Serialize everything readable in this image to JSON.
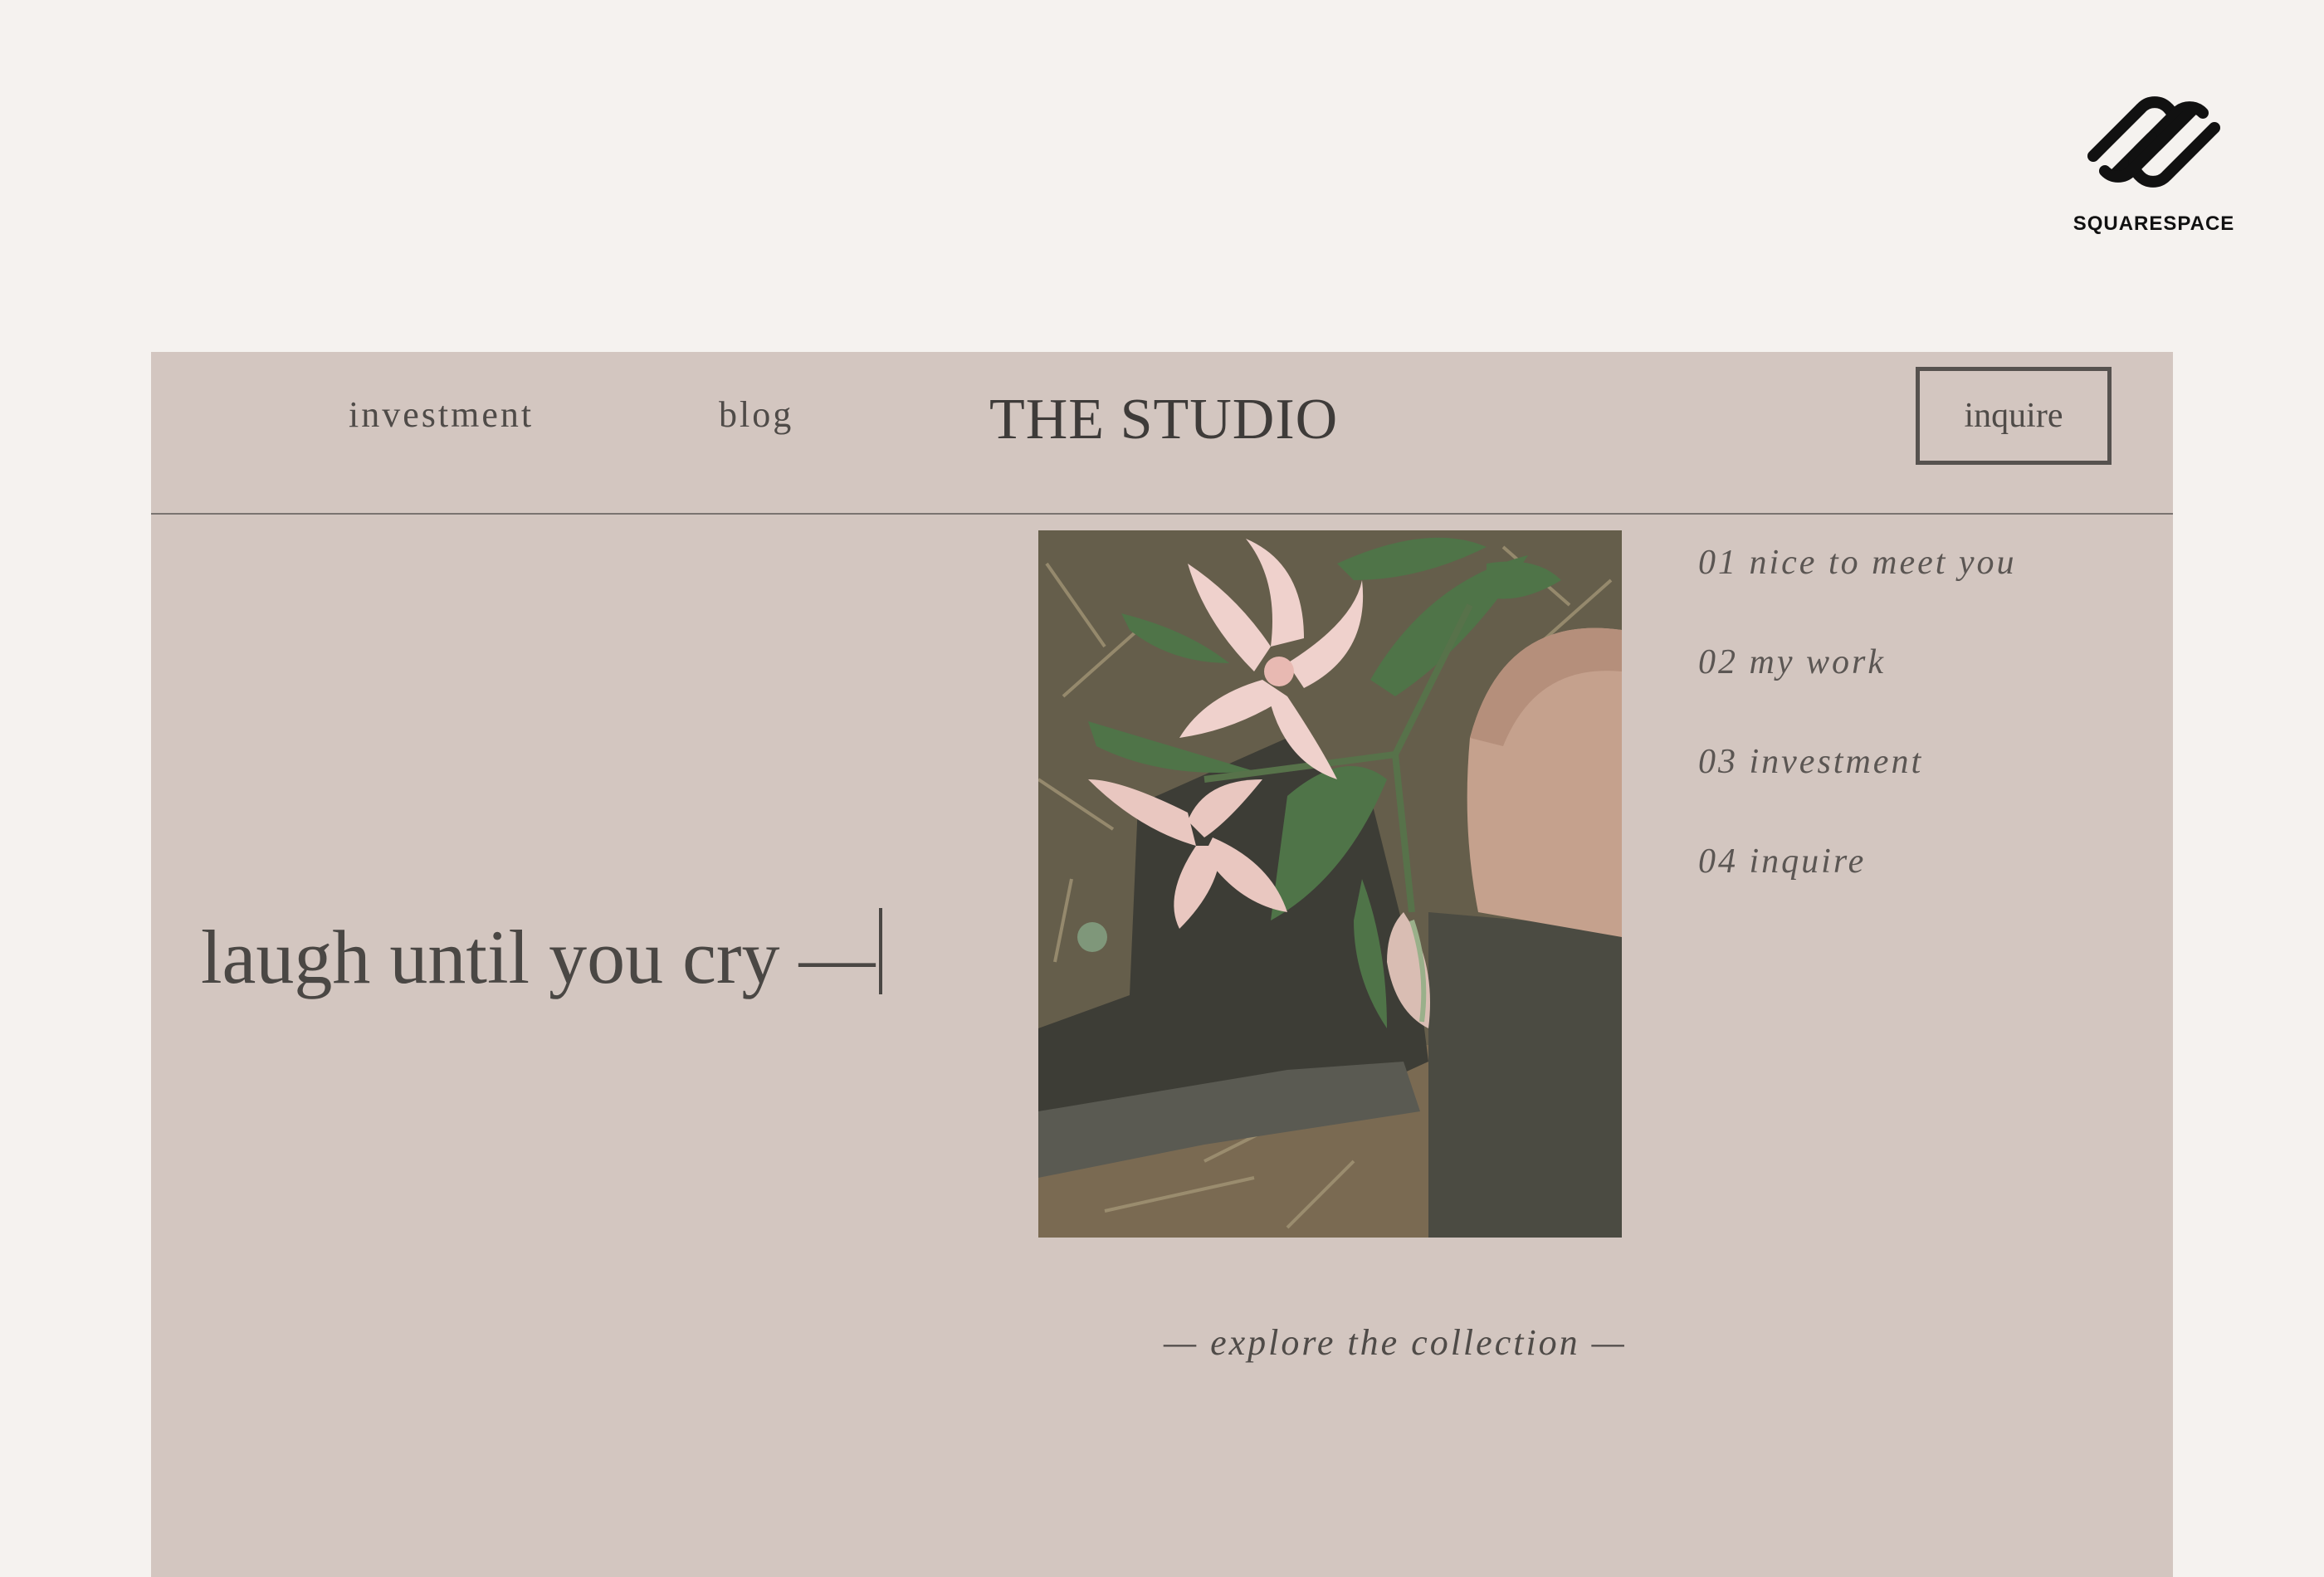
{
  "brand": {
    "logo_text": "SQUARESPACE",
    "logo_icon": "squarespace-logo-icon"
  },
  "site": {
    "nav": {
      "investment_label": "investment",
      "blog_label": "blog",
      "title": "THE STUDIO",
      "inquire_label": "inquire"
    },
    "hero": {
      "headline": "laugh until you cry —",
      "image_alt": "Pink lilies resting on dark rubber boots in dry grass"
    },
    "side_menu": [
      {
        "label": "01 nice to meet you"
      },
      {
        "label": "02 my work"
      },
      {
        "label": "03 investment"
      },
      {
        "label": "04 inquire"
      }
    ],
    "explore_label": "— explore the collection —"
  },
  "colors": {
    "page_background": "#f5f2ef",
    "panel_background": "#d3c6c0",
    "text": "#4a4744"
  }
}
